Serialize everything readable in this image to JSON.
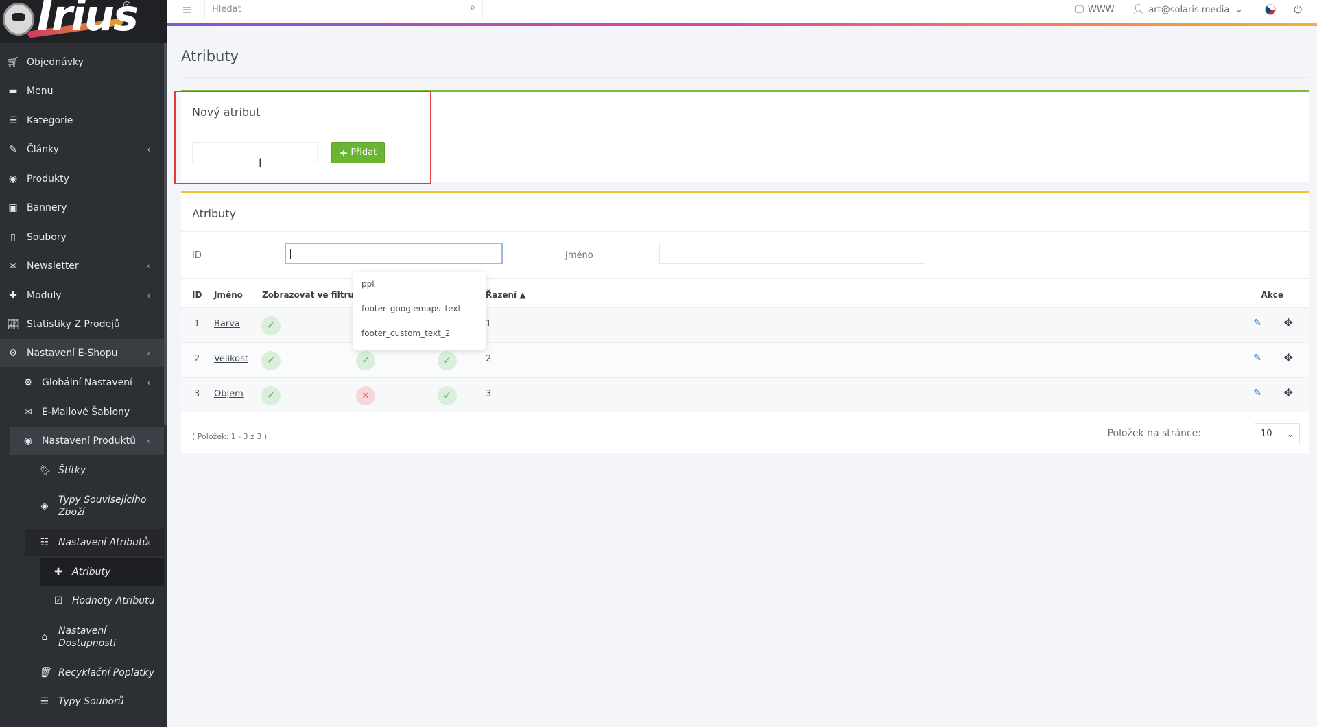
{
  "sidebar": {
    "logo_text": "Irius",
    "items": [
      {
        "label": "Objednávky"
      },
      {
        "label": "Menu"
      },
      {
        "label": "Kategorie"
      },
      {
        "label": "Články"
      },
      {
        "label": "Produkty"
      },
      {
        "label": "Bannery"
      },
      {
        "label": "Soubory"
      },
      {
        "label": "Newsletter"
      },
      {
        "label": "Moduly"
      },
      {
        "label": "Statistiky Z Prodejů"
      },
      {
        "label": "Nastavení E-Shopu"
      }
    ],
    "shop_sub": [
      {
        "label": "Globální Nastavení"
      },
      {
        "label": "E-Mailové Šablony"
      },
      {
        "label": "Nastavení Produktů"
      }
    ],
    "product_sub": [
      {
        "label": "Štítky"
      },
      {
        "label": "Typy Souvisejícího Zboží"
      },
      {
        "label": "Nastavení Atributů"
      },
      {
        "label": "Nastavení Dostupnosti"
      },
      {
        "label": "Recyklační Poplatky"
      },
      {
        "label": "Typy Souborů"
      }
    ],
    "attr_sub": [
      {
        "label": "Atributy"
      },
      {
        "label": "Hodnoty Atributu"
      }
    ]
  },
  "topbar": {
    "search_placeholder": "Hledat",
    "www_label": "WWW",
    "user_email": "art@solaris.media"
  },
  "page": {
    "title": "Atributy"
  },
  "new_attribute": {
    "title": "Nový atribut",
    "input_value": "",
    "add_label": "Přidat"
  },
  "attributes": {
    "title": "Atributy",
    "filter_id_label": "ID",
    "filter_name_label": "Jméno",
    "filter_id_value": "",
    "filter_name_value": "",
    "columns": {
      "id": "ID",
      "name": "Jméno",
      "show_in_filter": "Zobrazovat ve filtru",
      "sort": "Řazení",
      "actions": "Akce"
    },
    "rows": [
      {
        "id": "1",
        "name": "Barva",
        "sort": "1"
      },
      {
        "id": "2",
        "name": "Velikost",
        "sort": "2"
      },
      {
        "id": "3",
        "name": "Objem",
        "sort": "3"
      }
    ],
    "footer_note": "( Položek: 1 - 3 z 3 )",
    "per_page_label": "Položek na stránce:",
    "per_page_value": "10"
  },
  "autocomplete": {
    "options": [
      "ppl",
      "footer_googlemaps_text",
      "footer_custom_text_2"
    ]
  }
}
